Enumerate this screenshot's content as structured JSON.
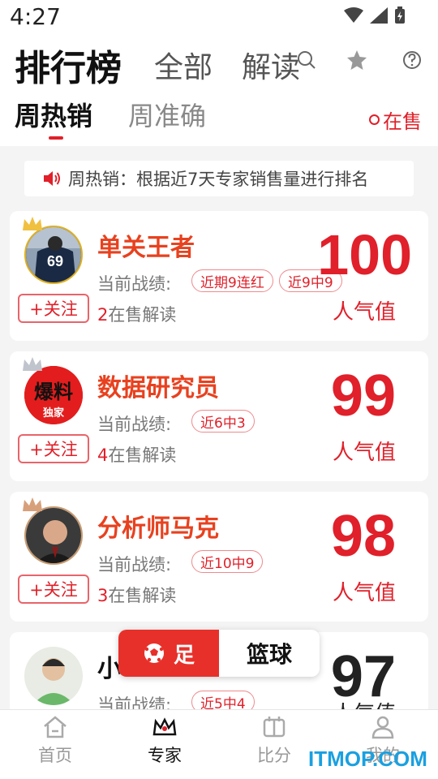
{
  "status_bar": {
    "time": "4:27"
  },
  "header": {
    "title": "排行榜",
    "tabs": [
      "全部",
      "解读"
    ],
    "subtabs": [
      "周热销",
      "周准确"
    ],
    "on_sale_filter": "在售"
  },
  "notice": {
    "text": "周热销：根据近7天专家销售量进行排名"
  },
  "experts": [
    {
      "name": "单关王者",
      "record_label": "当前战绩:",
      "badges": [
        "近期9连红",
        "近9中9"
      ],
      "on_sale_count": "2",
      "on_sale_suffix": "在售解读",
      "follow_label": "+关注",
      "score": "100",
      "score_label": "人气值",
      "jersey": "69"
    },
    {
      "name": "数据研究员",
      "record_label": "当前战绩:",
      "badges": [
        "近6中3"
      ],
      "on_sale_count": "4",
      "on_sale_suffix": "在售解读",
      "follow_label": "+关注",
      "score": "99",
      "score_label": "人气值",
      "avatar_text_top": "爆料",
      "avatar_text_bottom": "独家"
    },
    {
      "name": "分析师马克",
      "record_label": "当前战绩:",
      "badges": [
        "近10中9"
      ],
      "on_sale_count": "3",
      "on_sale_suffix": "在售解读",
      "follow_label": "+关注",
      "score": "98",
      "score_label": "人气值"
    },
    {
      "name": "小",
      "record_label": "当前战绩:",
      "badges": [
        "近5中4"
      ],
      "score": "97",
      "score_label": "人气值"
    }
  ],
  "sport_toggle": {
    "football": "足",
    "basketball": "篮球"
  },
  "tabbar": [
    {
      "label": "首页",
      "icon": "home-icon",
      "active": false
    },
    {
      "label": "专家",
      "icon": "crown-icon",
      "active": true
    },
    {
      "label": "比分",
      "icon": "scoreboard-icon",
      "active": false
    },
    {
      "label": "我的",
      "icon": "person-icon",
      "active": false
    }
  ],
  "watermark": "ITMOP.COM",
  "colors": {
    "accent": "#e0202a",
    "name": "#e8411f"
  }
}
